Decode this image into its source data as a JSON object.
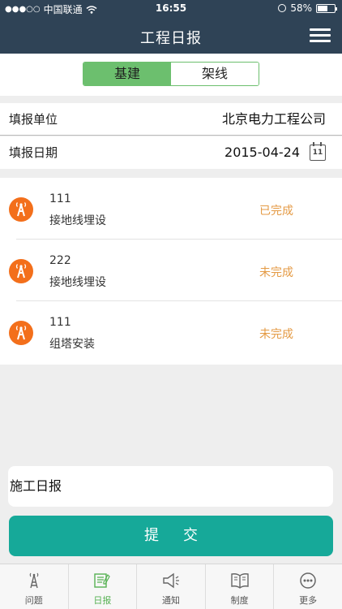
{
  "status_bar": {
    "carrier": "中国联通",
    "time": "16:55",
    "battery": "58%",
    "battery_level": 0.58
  },
  "nav": {
    "title": "工程日报"
  },
  "segment": {
    "tabs": [
      "基建",
      "架线"
    ],
    "selected": 0
  },
  "form": {
    "unit_label": "填报单位",
    "unit_value": "北京电力工程公司",
    "date_label": "填报日期",
    "date_value": "2015-04-24",
    "calendar_day": "11"
  },
  "tasks": [
    {
      "code": "111",
      "name": "接地线埋设",
      "status": "已完成"
    },
    {
      "code": "222",
      "name": "接地线埋设",
      "status": "未完成"
    },
    {
      "code": "111",
      "name": "组塔安装",
      "status": "未完成"
    }
  ],
  "note": {
    "value": "施工日报"
  },
  "submit_label": "提交",
  "tabbar": [
    {
      "label": "问题",
      "icon": "tower-icon"
    },
    {
      "label": "日报",
      "icon": "report-icon",
      "active": true
    },
    {
      "label": "通知",
      "icon": "megaphone-icon"
    },
    {
      "label": "制度",
      "icon": "book-icon"
    },
    {
      "label": "更多",
      "icon": "more-icon"
    }
  ],
  "colors": {
    "nav_bg": "#2f4356",
    "accent_green": "#6cbf6e",
    "submit_teal": "#16a999",
    "status_orange": "#e49a44",
    "icon_orange": "#f36f1b",
    "tab_active": "#56b153"
  }
}
